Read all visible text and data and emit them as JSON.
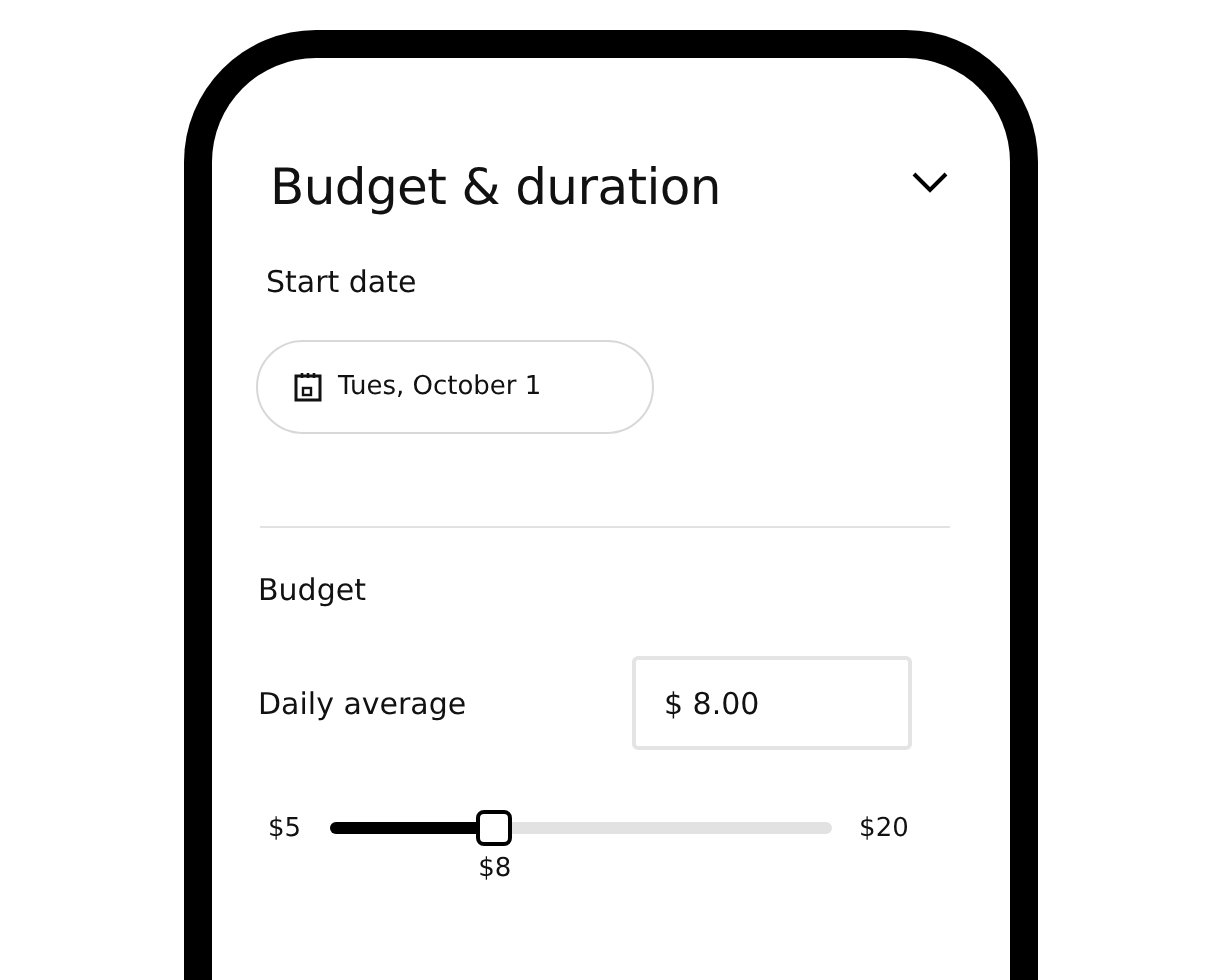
{
  "panel": {
    "title": "Budget & duration",
    "expanded": true
  },
  "start_date": {
    "label": "Start date",
    "value": "Tues, October 1"
  },
  "budget": {
    "heading": "Budget",
    "field_label": "Daily average",
    "value": "$ 8.00",
    "slider": {
      "min_label": "$5",
      "max_label": "$20",
      "value_label": "$8",
      "level": 0.33
    }
  }
}
